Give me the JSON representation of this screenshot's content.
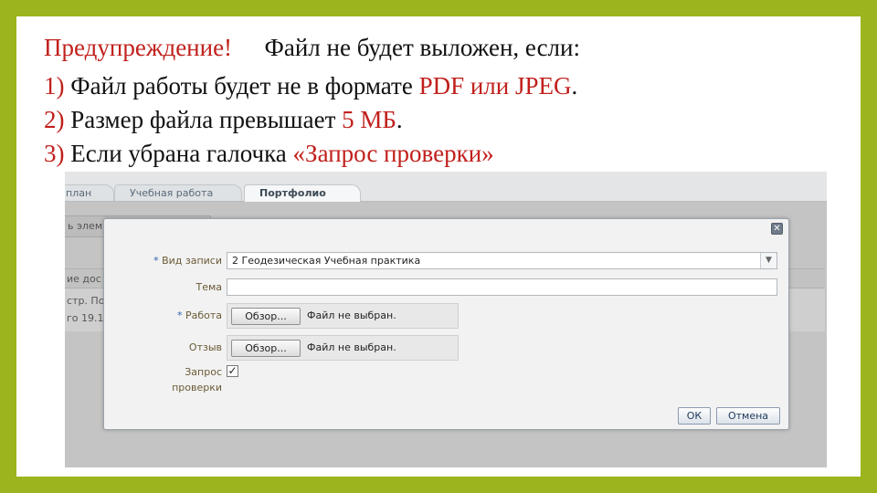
{
  "slide": {
    "line0": {
      "warning": "Предупреждение!",
      "text": "Файл не будет выложен, если:"
    },
    "line1": {
      "num": "1)",
      "text": "Файл работы будет не в формате ",
      "highlight": "PDF или JPEG",
      "end": "."
    },
    "line2": {
      "num": "2)",
      "text": "Размер файла превышает ",
      "highlight": "5 МБ",
      "end": "."
    },
    "line3": {
      "num": "3)",
      "text": "Если убрана галочка ",
      "highlight": "«Запрос проверки»"
    }
  },
  "screenshot": {
    "tabs": [
      "план",
      "Учебная работа",
      "Портфолио"
    ],
    "background": {
      "button_fragment": "ь элем",
      "header_fragment": "ие дос",
      "row_line1": "стр. По",
      "row_line2": "го 19.1"
    },
    "dialog": {
      "close_icon": "close-icon",
      "record_type_label": "Вид записи",
      "record_type_value": "2 Геодезическая Учебная практика",
      "subject_label": "Тема",
      "subject_value": "",
      "work_label": "Работа",
      "review_label": "Отзыв",
      "browse_label": "Обзор...",
      "no_file_text": "Файл не выбран.",
      "request_check_label_1": "Запрос",
      "request_check_label_2": "проверки",
      "request_check_checked": true,
      "ok_label": "ОК",
      "cancel_label": "Отмена",
      "required_mark": "*"
    }
  },
  "colors": {
    "frame": "#9cb41e",
    "accent_red": "#c0201c"
  }
}
